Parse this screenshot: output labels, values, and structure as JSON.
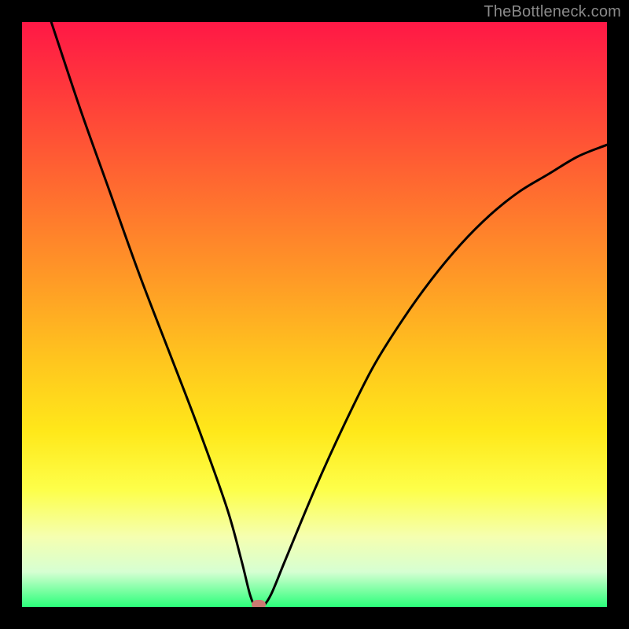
{
  "watermark": "TheBottleneck.com",
  "chart_data": {
    "type": "line",
    "title": "",
    "xlabel": "",
    "ylabel": "",
    "xlim": [
      0,
      1
    ],
    "ylim": [
      0,
      1
    ],
    "series": [
      {
        "name": "curve",
        "x": [
          0.05,
          0.1,
          0.15,
          0.2,
          0.25,
          0.3,
          0.35,
          0.375,
          0.39,
          0.4,
          0.41,
          0.425,
          0.45,
          0.5,
          0.55,
          0.6,
          0.65,
          0.7,
          0.75,
          0.8,
          0.85,
          0.9,
          0.95,
          1.0
        ],
        "y": [
          1.0,
          0.85,
          0.71,
          0.57,
          0.44,
          0.31,
          0.17,
          0.08,
          0.02,
          0.0,
          0.0,
          0.02,
          0.08,
          0.2,
          0.31,
          0.41,
          0.49,
          0.56,
          0.62,
          0.67,
          0.71,
          0.74,
          0.77,
          0.79
        ]
      }
    ],
    "marker": {
      "x": 0.405,
      "y": 0.0
    },
    "background_gradient": {
      "stops": [
        {
          "pos": 0.0,
          "color": "#ff1846"
        },
        {
          "pos": 0.12,
          "color": "#ff3a3b"
        },
        {
          "pos": 0.28,
          "color": "#ff6a30"
        },
        {
          "pos": 0.44,
          "color": "#ff9a26"
        },
        {
          "pos": 0.58,
          "color": "#ffc61e"
        },
        {
          "pos": 0.7,
          "color": "#ffe81a"
        },
        {
          "pos": 0.8,
          "color": "#fdff4a"
        },
        {
          "pos": 0.88,
          "color": "#f5ffb0"
        },
        {
          "pos": 0.94,
          "color": "#d6ffd2"
        },
        {
          "pos": 1.0,
          "color": "#2bff7a"
        }
      ]
    }
  }
}
